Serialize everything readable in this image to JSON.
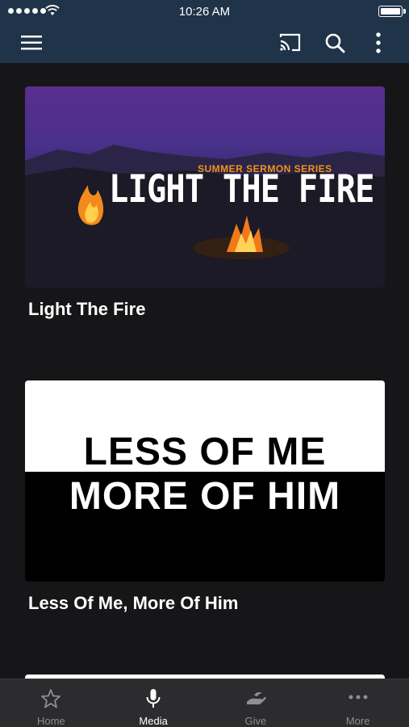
{
  "status_bar": {
    "time": "10:26 AM"
  },
  "top_bar": {
    "icons": [
      "menu-icon",
      "cast-icon",
      "search-icon",
      "more-vert-icon"
    ]
  },
  "media_items": [
    {
      "title": "Light The Fire",
      "artwork": {
        "series_label": "SUMMER SERMON SERIES",
        "title_text": "LIGHT THE FIRE"
      }
    },
    {
      "title": "Less Of Me, More Of Him",
      "artwork": {
        "line1": "LESS OF ME",
        "line2": "MORE OF HIM"
      }
    }
  ],
  "tabs": [
    {
      "label": "Home",
      "icon": "star-icon",
      "active": false
    },
    {
      "label": "Media",
      "icon": "microphone-icon",
      "active": true
    },
    {
      "label": "Give",
      "icon": "give-hand-icon",
      "active": false
    },
    {
      "label": "More",
      "icon": "more-horiz-icon",
      "active": false
    }
  ],
  "colors": {
    "header": "#1f3349",
    "background": "#161618",
    "tab_bar": "#2c2c2e",
    "inactive_tab": "#8e8e93",
    "series_accent": "#f0931e"
  }
}
